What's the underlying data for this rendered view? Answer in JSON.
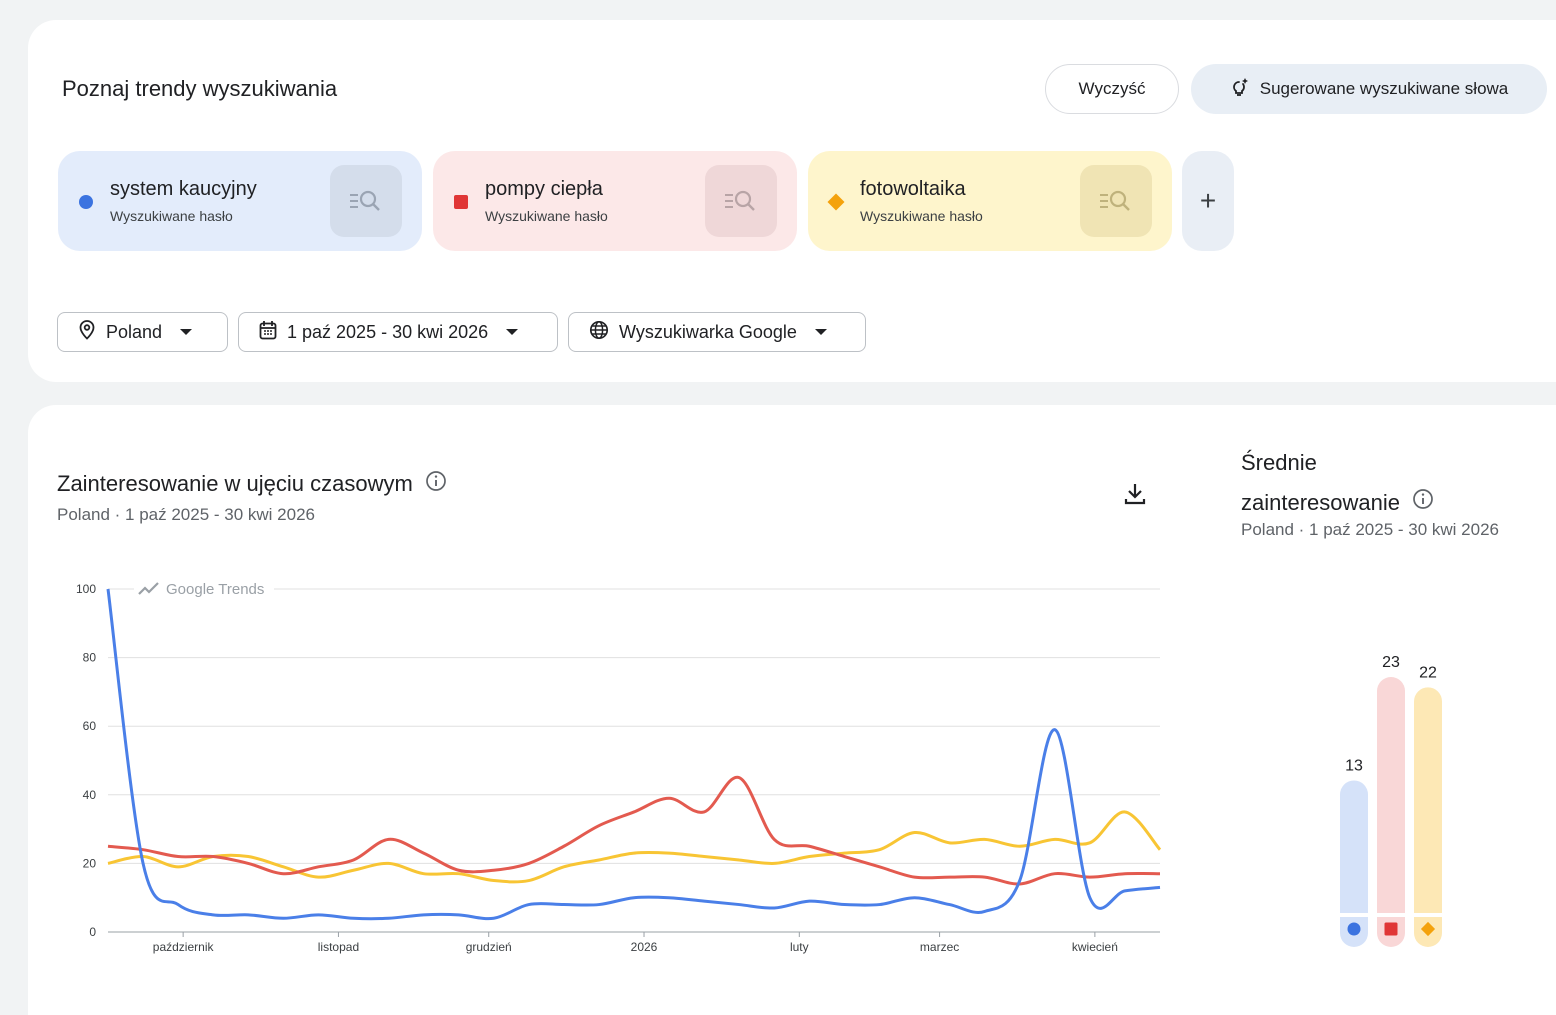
{
  "explore": {
    "title": "Poznaj trendy wyszukiwania",
    "clear_label": "Wyczyść",
    "suggest_label": "Sugerowane wyszukiwane słowa"
  },
  "terms": [
    {
      "name": "system kaucyjny",
      "type": "Wyszukiwane hasło",
      "color": "#3b73e0",
      "marker": "circle"
    },
    {
      "name": "pompy ciepła",
      "type": "Wyszukiwane hasło",
      "color": "#e03636",
      "marker": "square"
    },
    {
      "name": "fotowoltaika",
      "type": "Wyszukiwane hasło",
      "color": "#f4a20c",
      "marker": "diamond"
    }
  ],
  "filters": {
    "location": "Poland",
    "date_range": "1 paź 2025 - 30 kwi 2026",
    "source": "Wyszukiwarka Google"
  },
  "interest_over_time": {
    "title": "Zainteresowanie w ujęciu czasowym",
    "subtitle": "Poland  ·  1 paź 2025 - 30 kwi 2026",
    "watermark": "Google Trends"
  },
  "average_interest": {
    "title_line1": "Średnie",
    "title_line2": "zainteresowanie",
    "subtitle": "Poland  ·  1 paź 2025 - 30 kwi 2026"
  },
  "chart_data": [
    {
      "type": "line",
      "title": "Zainteresowanie w ujęciu czasowym",
      "x_tick_labels": [
        "październik",
        "listopad",
        "grudzień",
        "2026",
        "luty",
        "marzec",
        "kwiecień"
      ],
      "ylim": [
        0,
        100
      ],
      "y_ticks": [
        0,
        20,
        40,
        60,
        80,
        100
      ],
      "grid": true,
      "x": [
        "2025-10-01",
        "2025-10-08",
        "2025-10-15",
        "2025-10-22",
        "2025-10-29",
        "2025-11-05",
        "2025-11-12",
        "2025-11-19",
        "2025-11-26",
        "2025-12-03",
        "2025-12-10",
        "2025-12-17",
        "2025-12-24",
        "2025-12-31",
        "2026-01-07",
        "2026-01-14",
        "2026-01-21",
        "2026-01-28",
        "2026-02-04",
        "2026-02-11",
        "2026-02-18",
        "2026-02-25",
        "2026-03-04",
        "2026-03-11",
        "2026-03-18",
        "2026-03-25",
        "2026-04-01",
        "2026-04-08",
        "2026-04-15",
        "2026-04-22",
        "2026-04-29"
      ],
      "series": [
        {
          "name": "system kaucyjny",
          "color": "#4a7fe8",
          "values": [
            100,
            20,
            8,
            5,
            5,
            4,
            5,
            4,
            4,
            5,
            5,
            4,
            8,
            8,
            8,
            10,
            10,
            9,
            8,
            7,
            9,
            8,
            8,
            10,
            8,
            6,
            15,
            59,
            10,
            12,
            13
          ]
        },
        {
          "name": "pompy ciepła",
          "color": "#e35a4f",
          "values": [
            25,
            24,
            22,
            22,
            20,
            17,
            19,
            21,
            27,
            23,
            18,
            18,
            20,
            25,
            31,
            35,
            39,
            35,
            45,
            27,
            25,
            22,
            19,
            16,
            16,
            16,
            14,
            17,
            16,
            17,
            17
          ]
        },
        {
          "name": "fotowoltaika",
          "color": "#f8c534",
          "values": [
            20,
            22,
            19,
            22,
            22,
            19,
            16,
            18,
            20,
            17,
            17,
            15,
            15,
            19,
            21,
            23,
            23,
            22,
            21,
            20,
            22,
            23,
            24,
            29,
            26,
            27,
            25,
            27,
            26,
            35,
            24
          ]
        }
      ]
    },
    {
      "type": "bar",
      "title": "Średnie zainteresowanie",
      "categories": [
        "system kaucyjny",
        "pompy ciepła",
        "fotowoltaika"
      ],
      "values": [
        13,
        23,
        22
      ],
      "colors": [
        "#d5e2f9",
        "#f9d7d7",
        "#fde8b5"
      ],
      "marker_colors": [
        "#3b73e0",
        "#e03636",
        "#f4a20c"
      ]
    }
  ]
}
